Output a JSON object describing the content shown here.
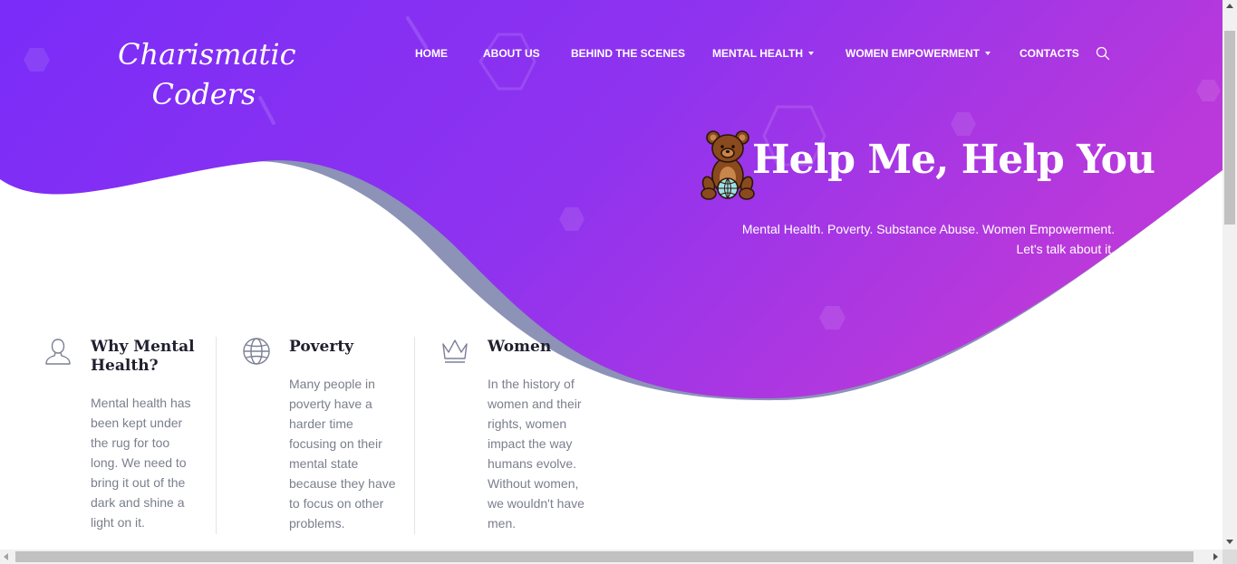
{
  "brand": {
    "line1": "Charismatic",
    "line2": "Coders"
  },
  "nav": {
    "items": [
      {
        "label": "HOME",
        "dropdown": false
      },
      {
        "label": "ABOUT US",
        "dropdown": false
      },
      {
        "label": "BEHIND THE SCENES",
        "dropdown": false
      },
      {
        "label": "MENTAL HEALTH",
        "dropdown": true
      },
      {
        "label": "WOMEN EMPOWERMENT",
        "dropdown": true
      },
      {
        "label": "CONTACTS",
        "dropdown": false
      }
    ],
    "search_icon": "search-icon"
  },
  "hero": {
    "title": "Help Me, Help You",
    "subtitle_line1": "Mental Health. Poverty. Substance Abuse. Women Empowerment.",
    "subtitle_line2": "Let's talk about it.",
    "mascot_icon": "teddy-bear-with-globe-icon"
  },
  "features": [
    {
      "icon": "user-icon",
      "title_line1": "Why Mental",
      "title_line2": "Health?",
      "text_lines": [
        "Mental health has",
        "been kept under",
        "the rug for too",
        "long. We need to",
        "bring it out of the",
        "dark and shine a",
        "light on it."
      ]
    },
    {
      "icon": "globe-icon",
      "title_line1": "Poverty",
      "title_line2": "",
      "text_lines": [
        "Many people in",
        "poverty have a",
        "harder time",
        "focusing on their",
        "mental state",
        "because they have",
        "to focus on other",
        "problems."
      ]
    },
    {
      "icon": "crown-icon",
      "title_line1": "Women",
      "title_line2": "",
      "text_lines": [
        "In the history of",
        "women and their",
        "rights, women",
        "impact the way",
        "humans evolve.",
        "Without women,",
        "we wouldn't have",
        "men."
      ]
    }
  ],
  "colors": {
    "gradient_start": "#7b2ff7",
    "gradient_end": "#b93bdc",
    "wave_shadow": "#8890b5",
    "heading": "#1f1f2e",
    "body_text": "#7a7f8c",
    "icon_stroke": "#7c8095"
  }
}
